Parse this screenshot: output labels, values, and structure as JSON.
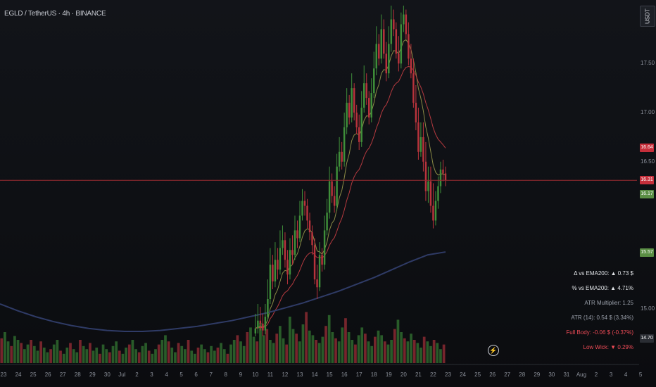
{
  "header": {
    "title": "EGLD / TetherUS · 4h · BINANCE"
  },
  "symbol_badge": "USDT",
  "price_axis": {
    "labels": [
      {
        "text": "17.50",
        "value": 17.5
      },
      {
        "text": "17.00",
        "value": 17.0
      },
      {
        "text": "16.50",
        "value": 16.5
      },
      {
        "text": "15.00",
        "value": 15.0
      }
    ],
    "tags": [
      {
        "text": "16.64",
        "value": 16.64,
        "color": "#c62f3b"
      },
      {
        "text": "16.31",
        "value": 16.31,
        "color": "#c62f3b"
      },
      {
        "text": "16.17",
        "value": 16.17,
        "color": "#5a8e44"
      },
      {
        "text": "15.57",
        "value": 15.57,
        "color": "#5a8e44"
      },
      {
        "text": "14.70",
        "value": 14.7,
        "color": "#2a2d33"
      }
    ]
  },
  "stats_panel": [
    {
      "text": "Δ vs EMA200: ▲ 0.73 $",
      "color": "#e2e4e8"
    },
    {
      "text": "% vs EMA200: ▲ 4.71%",
      "color": "#e2e4e8"
    },
    {
      "text": "ATR Multiplier: 1.25",
      "color": "#9aa0aa"
    },
    {
      "text": "ATR (14): 0.54 $ (3.34%)",
      "color": "#9aa0aa"
    },
    {
      "text": "Full Body: -0.06 $ (-0.37%)",
      "color": "#ef4b56"
    },
    {
      "text": "Low Wick: ▼ 0.29%",
      "color": "#ef4b56"
    }
  ],
  "chart_data": {
    "type": "candlestick",
    "x_ticks": [
      "23",
      "24",
      "25",
      "26",
      "27",
      "28",
      "29",
      "30",
      "Jul",
      "2",
      "3",
      "4",
      "5",
      "6",
      "7",
      "8",
      "9",
      "10",
      "11",
      "12",
      "13",
      "14",
      "15",
      "16",
      "17",
      "18",
      "19",
      "20",
      "21",
      "22",
      "23",
      "24",
      "25",
      "26",
      "27",
      "28",
      "29",
      "30",
      "31",
      "Aug",
      "2",
      "3",
      "4",
      "5"
    ],
    "ylim": [
      14.72,
      18.09
    ],
    "current_price": 16.31,
    "colors": {
      "up": "#3f8f3a",
      "down": "#b8333c",
      "ema_fast": "#8a8a45",
      "ema_mid": "#b53a3f",
      "ema_slow": "#2f3b66",
      "price_line": "#9b2b30"
    },
    "candles": {
      "start_day_index": 17,
      "per_day": 6,
      "open": [
        14.75,
        14.8,
        14.88,
        14.85,
        14.78,
        14.92,
        15.1,
        15.45,
        15.28,
        15.5,
        15.4,
        15.62,
        15.7,
        15.5,
        15.35,
        15.6,
        15.55,
        15.8,
        15.72,
        15.95,
        16.1,
        16.05,
        15.9,
        15.78,
        15.65,
        15.3,
        15.22,
        15.55,
        15.45,
        15.8,
        15.98,
        16.3,
        16.15,
        16.05,
        16.45,
        16.6,
        16.5,
        16.85,
        17.1,
        16.95,
        17.25,
        17.0,
        16.85,
        16.7,
        17.05,
        17.3,
        17.15,
        16.95,
        17.2,
        17.45,
        17.7,
        17.55,
        17.85,
        17.6,
        17.4,
        17.7,
        17.95,
        17.85,
        17.6,
        17.5,
        17.9,
        18.0,
        17.8,
        17.55,
        17.4,
        17.1,
        16.9,
        16.6,
        16.75,
        16.5,
        16.2,
        16.3,
        16.05,
        15.9,
        16.1,
        16.25,
        16.42,
        16.38
      ],
      "close": [
        14.8,
        14.88,
        14.85,
        14.78,
        14.92,
        15.1,
        15.45,
        15.28,
        15.5,
        15.4,
        15.62,
        15.7,
        15.5,
        15.35,
        15.6,
        15.55,
        15.8,
        15.72,
        15.95,
        16.1,
        16.05,
        15.9,
        15.78,
        15.65,
        15.3,
        15.22,
        15.55,
        15.45,
        15.8,
        15.98,
        16.3,
        16.15,
        16.05,
        16.45,
        16.6,
        16.5,
        16.85,
        17.1,
        16.95,
        17.25,
        17.0,
        16.85,
        16.7,
        17.05,
        17.3,
        17.15,
        16.95,
        17.2,
        17.45,
        17.7,
        17.55,
        17.85,
        17.6,
        17.4,
        17.7,
        17.95,
        17.85,
        17.6,
        17.5,
        17.9,
        18.0,
        17.8,
        17.55,
        17.4,
        17.1,
        16.9,
        16.6,
        16.75,
        16.5,
        16.2,
        16.3,
        16.05,
        15.9,
        16.1,
        16.25,
        16.42,
        16.38,
        16.31
      ],
      "high": [
        14.95,
        15.05,
        15.02,
        14.95,
        15.05,
        15.3,
        15.62,
        15.55,
        15.68,
        15.62,
        15.8,
        15.85,
        15.78,
        15.6,
        15.72,
        15.75,
        15.95,
        15.9,
        16.1,
        16.22,
        16.2,
        16.12,
        15.98,
        15.85,
        15.72,
        15.45,
        15.68,
        15.62,
        15.95,
        16.12,
        16.45,
        16.38,
        16.25,
        16.58,
        16.75,
        16.7,
        17.0,
        17.25,
        17.18,
        17.4,
        17.3,
        17.08,
        16.98,
        17.22,
        17.48,
        17.4,
        17.22,
        17.35,
        17.62,
        17.88,
        17.8,
        18.0,
        17.95,
        17.72,
        17.88,
        18.09,
        18.05,
        17.92,
        17.78,
        18.02,
        18.09,
        18.05,
        17.92,
        17.7,
        17.55,
        17.28,
        17.05,
        16.9,
        16.9,
        16.7,
        16.45,
        16.45,
        16.28,
        16.2,
        16.35,
        16.5,
        16.52,
        16.45
      ],
      "low": [
        14.72,
        14.75,
        14.78,
        14.72,
        14.74,
        14.88,
        15.05,
        15.2,
        15.22,
        15.3,
        15.35,
        15.55,
        15.42,
        15.25,
        15.3,
        15.45,
        15.5,
        15.62,
        15.68,
        15.9,
        15.95,
        15.82,
        15.7,
        15.55,
        15.25,
        15.1,
        15.18,
        15.38,
        15.4,
        15.75,
        15.92,
        16.08,
        15.98,
        16.0,
        16.4,
        16.42,
        16.45,
        16.78,
        16.88,
        16.9,
        16.92,
        16.78,
        16.62,
        16.65,
        17.0,
        17.08,
        16.88,
        16.9,
        17.15,
        17.38,
        17.48,
        17.5,
        17.55,
        17.32,
        17.35,
        17.62,
        17.78,
        17.55,
        17.42,
        17.45,
        17.82,
        17.75,
        17.48,
        17.35,
        17.05,
        16.82,
        16.52,
        16.55,
        16.4,
        16.1,
        16.08,
        15.98,
        15.82,
        15.85,
        16.02,
        16.18,
        16.3,
        16.25
      ]
    },
    "ema200": [
      15.05,
      14.98,
      14.92,
      14.87,
      14.83,
      14.8,
      14.78,
      14.77,
      14.77,
      14.78,
      14.8,
      14.82,
      14.85,
      14.88,
      14.92,
      14.96,
      15.01,
      15.06,
      15.12,
      15.18,
      15.25,
      15.32,
      15.4,
      15.48,
      15.55,
      15.58
    ],
    "volume": {
      "scale_max": 100,
      "values": [
        32,
        40,
        28,
        22,
        35,
        30,
        26,
        18,
        24,
        30,
        22,
        16,
        28,
        20,
        14,
        18,
        24,
        30,
        16,
        12,
        20,
        26,
        18,
        14,
        30,
        22,
        18,
        26,
        16,
        20,
        12,
        24,
        18,
        14,
        22,
        28,
        16,
        12,
        20,
        24,
        30,
        18,
        14,
        22,
        26,
        16,
        12,
        18,
        24,
        30,
        36,
        28,
        20,
        14,
        26,
        22,
        18,
        30,
        16,
        12,
        20,
        24,
        18,
        14,
        22,
        16,
        20,
        26,
        18,
        12,
        24,
        30,
        36,
        28,
        22,
        40,
        46,
        34,
        28,
        52,
        36,
        44,
        30,
        26,
        38,
        48,
        32,
        24,
        60,
        44,
        38,
        28,
        50,
        66,
        42,
        36,
        30,
        26,
        34,
        48,
        62,
        40,
        32,
        28,
        46,
        58,
        40,
        30,
        24,
        36,
        46,
        38,
        28,
        22,
        34,
        42,
        36,
        28,
        24,
        30,
        44,
        56,
        40,
        32,
        28,
        38,
        30,
        26,
        20,
        34,
        28,
        22,
        30,
        26,
        18,
        24
      ]
    }
  }
}
